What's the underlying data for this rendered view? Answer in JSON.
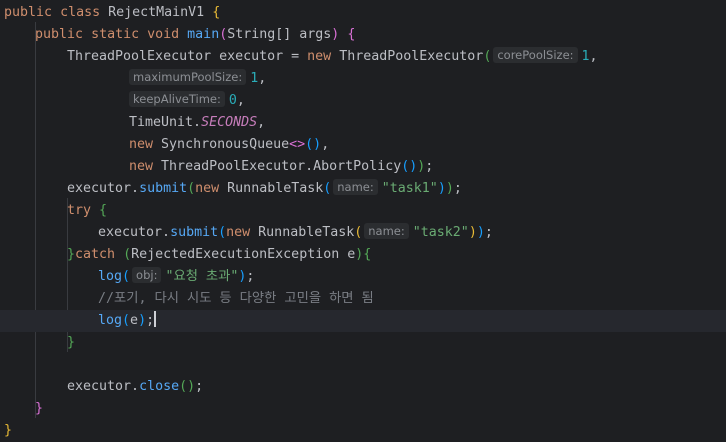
{
  "code": {
    "l1": {
      "kw1": "public",
      "kw2": "class",
      "name": "RejectMainV1",
      "brace": "{"
    },
    "l2": {
      "kw1": "public",
      "kw2": "static",
      "kw3": "void",
      "fn": "main",
      "p1": "(",
      "type": "String[] args",
      "p2": ")",
      "brace": "{"
    },
    "l3": {
      "decl": "ThreadPoolExecutor executor = ",
      "kw": "new",
      "cls": "ThreadPoolExecutor",
      "p": "(",
      "hint": "corePoolSize:",
      "num": "1",
      "comma": ","
    },
    "l4": {
      "hint": "maximumPoolSize:",
      "num": "1",
      "comma": ","
    },
    "l5": {
      "hint": "keepAliveTime:",
      "num": "0",
      "comma": ","
    },
    "l6": {
      "cls": "TimeUnit.",
      "const": "SECONDS",
      "comma": ","
    },
    "l7": {
      "kw": "new",
      "cls": "SynchronousQueue",
      "gen": "<>",
      "p1": "(",
      "p2": ")",
      "comma": ","
    },
    "l8": {
      "kw": "new",
      "cls": "ThreadPoolExecutor.AbortPolicy",
      "p1": "(",
      "p2": ")",
      "p3": ")",
      "semi": ";"
    },
    "l9": {
      "obj": "executor.",
      "fn": "submit",
      "p1": "(",
      "kw": "new",
      "cls": "RunnableTask",
      "p2": "(",
      "hint": "name:",
      "str": "\"task1\"",
      "p3": ")",
      "p4": ")",
      "semi": ";"
    },
    "l10": {
      "kw": "try",
      "brace": "{"
    },
    "l11": {
      "obj": "executor.",
      "fn": "submit",
      "p1": "(",
      "kw": "new",
      "cls": "RunnableTask",
      "p2": "(",
      "hint": "name:",
      "str": "\"task2\"",
      "p3": ")",
      "p4": ")",
      "semi": ";"
    },
    "l12": {
      "b1": "}",
      "kw": "catch",
      "p1": "(",
      "type": "RejectedExecutionException e",
      "p2": ")",
      "b2": "{"
    },
    "l13": {
      "fn": "log",
      "p1": "(",
      "hint": "obj:",
      "str": "\"요청 초과\"",
      "p2": ")",
      "semi": ";"
    },
    "l14": {
      "comment": "//포기, 다시 시도 등 다양한 고민을 하면 됨"
    },
    "l15": {
      "fn": "log",
      "p1": "(",
      "arg": "e",
      "p2": ")",
      "semi": ";"
    },
    "l16": {
      "brace": "}"
    },
    "l18": {
      "obj": "executor.",
      "fn": "close",
      "p1": "(",
      "p2": ")",
      "semi": ";"
    },
    "l19": {
      "brace": "}"
    },
    "l20": {
      "brace": "}"
    }
  },
  "colors": {
    "background": "#1e1f22",
    "current_line": "#26282e",
    "keyword": "#cf8e6d",
    "function": "#56a8f5",
    "string": "#6aab73",
    "number": "#2aacb8",
    "constant": "#c77dbb",
    "comment": "#7a7e85"
  }
}
